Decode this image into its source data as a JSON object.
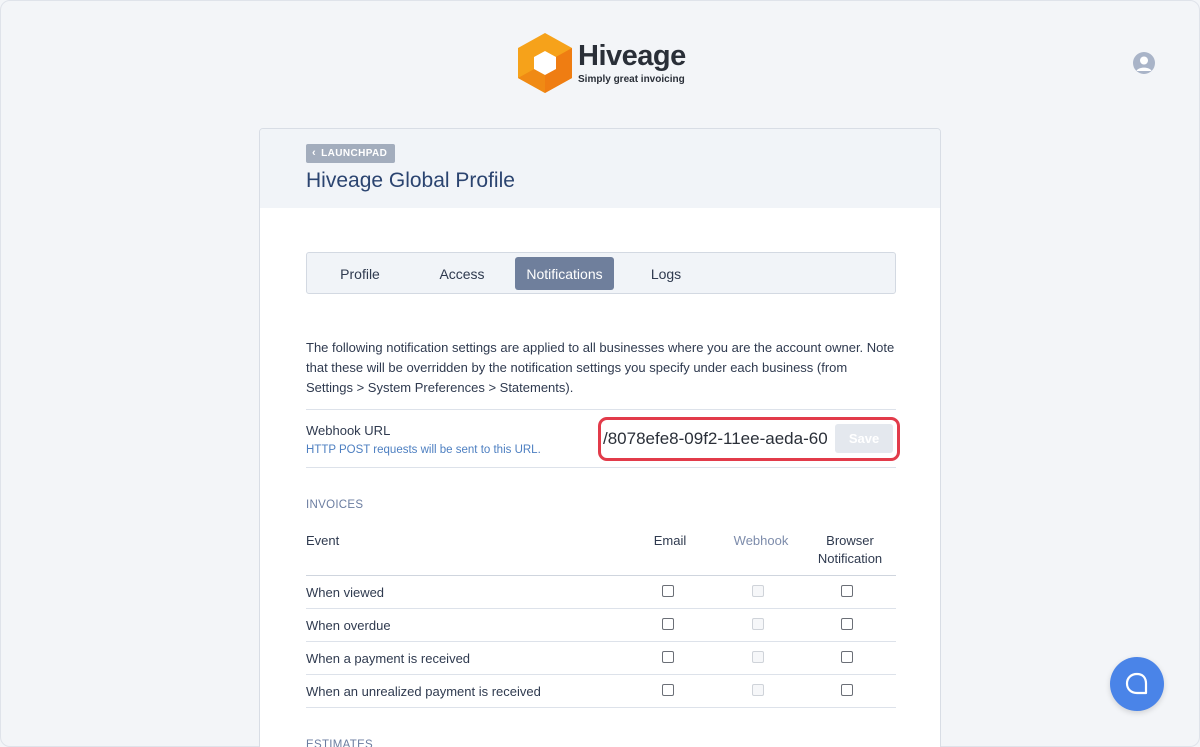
{
  "brand": {
    "name": "Hiveage",
    "tagline": "Simply great invoicing",
    "colors": {
      "logo_orange": "#f6a21a",
      "logo_dark": "#ef7d12",
      "accent": "#4a84e8",
      "highlight_border": "#e23b4a"
    }
  },
  "header": {
    "back_label": "LAUNCHPAD",
    "title": "Hiveage Global Profile"
  },
  "tabs": [
    {
      "label": "Profile",
      "active": false
    },
    {
      "label": "Access",
      "active": false
    },
    {
      "label": "Notifications",
      "active": true
    },
    {
      "label": "Logs",
      "active": false
    }
  ],
  "description": "The following notification settings are applied to all businesses where you are the account owner. Note that these will be overridden by the notification settings you specify under each business (from Settings > System Preferences > Statements).",
  "webhook": {
    "label": "Webhook URL",
    "hint": "HTTP POST requests will be sent to this URL.",
    "value": "/8078efe8-09f2-11ee-aeda-60",
    "save_label": "Save"
  },
  "invoices": {
    "section_title": "INVOICES",
    "columns": {
      "event": "Event",
      "email": "Email",
      "webhook": "Webhook",
      "browser_line1": "Browser",
      "browser_line2": "Notification"
    },
    "rows": [
      {
        "label": "When viewed",
        "email": false,
        "webhook": false,
        "browser": false
      },
      {
        "label": "When overdue",
        "email": false,
        "webhook": false,
        "browser": false
      },
      {
        "label": "When a payment is received",
        "email": false,
        "webhook": false,
        "browser": false
      },
      {
        "label": "When an unrealized payment is received",
        "email": false,
        "webhook": false,
        "browser": false
      }
    ]
  },
  "estimates": {
    "section_title": "ESTIMATES"
  },
  "icons": {
    "back": "chevron-left-icon",
    "avatar": "user-avatar-icon",
    "help": "chat-bubble-icon"
  }
}
